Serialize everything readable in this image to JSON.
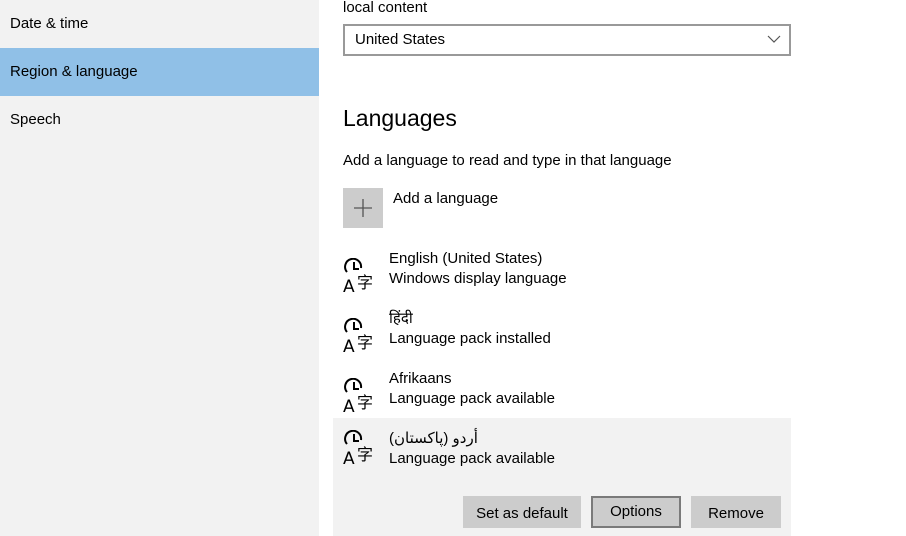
{
  "sidebar": {
    "items": [
      {
        "label": "Date & time",
        "selected": false
      },
      {
        "label": "Region & language",
        "selected": true
      },
      {
        "label": "Speech",
        "selected": false
      }
    ],
    "selected_color": "#90c0e7"
  },
  "region": {
    "label_tail": "local content",
    "country_value": "United States",
    "dropdown_icon": "chevron-down-icon"
  },
  "languages": {
    "heading": "Languages",
    "description": "Add a language to read and type in that language",
    "add_button_label": "Add a language",
    "add_icon": "plus-icon",
    "items": [
      {
        "name": "English (United States)",
        "status": "Windows display language",
        "icon": "language-icon"
      },
      {
        "name": "हिंदी",
        "status": "Language pack installed",
        "icon": "language-icon"
      },
      {
        "name": "Afrikaans",
        "status": "Language pack available",
        "icon": "language-icon"
      },
      {
        "name": "أردو (پاکستان)",
        "status": "Language pack available",
        "icon": "language-icon",
        "selected": true
      }
    ],
    "actions": {
      "set_default": "Set as default",
      "options": "Options",
      "remove": "Remove"
    }
  }
}
